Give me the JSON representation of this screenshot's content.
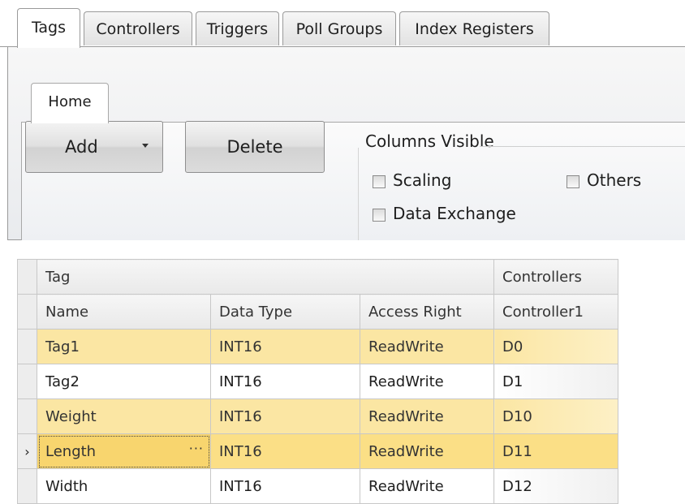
{
  "top_tabs": [
    "Tags",
    "Controllers",
    "Triggers",
    "Poll Groups",
    "Index Registers"
  ],
  "ribbon": {
    "home_tab": "Home",
    "add_label": "Add",
    "delete_label": "Delete",
    "columns_visible": {
      "title": "Columns Visible",
      "options": [
        "Scaling",
        "Others",
        "Data Exchange"
      ]
    }
  },
  "grid": {
    "band_tag": "Tag",
    "band_controllers": "Controllers",
    "columns": [
      "Name",
      "Data Type",
      "Access Right",
      "Controller1"
    ],
    "current_row_marker": "›",
    "ellipsis": "···",
    "rows": [
      {
        "name": "Tag1",
        "data_type": "INT16",
        "access_right": "ReadWrite",
        "address": "D0"
      },
      {
        "name": "Tag2",
        "data_type": "INT16",
        "access_right": "ReadWrite",
        "address": "D1"
      },
      {
        "name": "Weight",
        "data_type": "INT16",
        "access_right": "ReadWrite",
        "address": "D10"
      },
      {
        "name": "Length",
        "data_type": "INT16",
        "access_right": "ReadWrite",
        "address": "D11"
      },
      {
        "name": "Width",
        "data_type": "INT16",
        "access_right": "ReadWrite",
        "address": "D12"
      }
    ]
  },
  "colors": {
    "row_highlight": "#fbe6a3",
    "row_current": "#fbdf86",
    "grid_border": "#c8c8c8"
  }
}
